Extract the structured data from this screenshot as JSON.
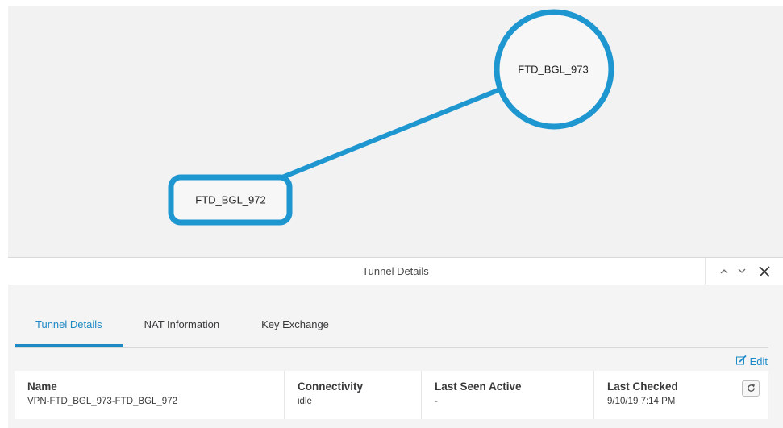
{
  "topology": {
    "nodes": [
      {
        "label": "FTD_BGL_973",
        "shape": "circle"
      },
      {
        "label": "FTD_BGL_972",
        "shape": "rounded-rect"
      }
    ],
    "link_color": "#1e96d0"
  },
  "panel": {
    "title": "Tunnel Details",
    "controls": {
      "collapse": "^",
      "expand": "v",
      "close": "X"
    }
  },
  "tabs": [
    {
      "label": "Tunnel Details",
      "active": true
    },
    {
      "label": "NAT Information",
      "active": false
    },
    {
      "label": "Key Exchange",
      "active": false
    }
  ],
  "edit_label": "Edit",
  "table": {
    "columns": [
      {
        "header": "Name",
        "value": "VPN-FTD_BGL_973-FTD_BGL_972"
      },
      {
        "header": "Connectivity",
        "value": "idle"
      },
      {
        "header": "Last Seen Active",
        "value": "-"
      },
      {
        "header": "Last Checked",
        "value": "9/10/19 7:14 PM"
      }
    ]
  },
  "colors": {
    "accent": "#1e8ac5",
    "topology_bg": "#f2f2f2"
  }
}
